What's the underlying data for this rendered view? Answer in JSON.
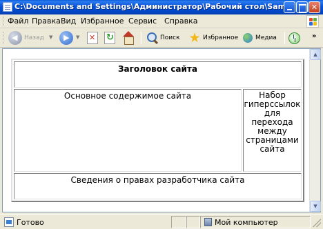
{
  "window": {
    "title": "C:\\Documents and Settings\\Администратор\\Рабочий стол\\Samples\\Macromed..."
  },
  "menu": {
    "items": [
      "Файл",
      "Правка",
      "Вид",
      "Избранное",
      "Сервис",
      "Справка"
    ]
  },
  "toolbar": {
    "back_label": "Назад",
    "search_label": "Поиск",
    "favorites_label": "Избранное",
    "media_label": "Медиа"
  },
  "page": {
    "header": "Заголовок сайта",
    "main_content": "Основное содержимое сайта",
    "sidebar": "Набор гиперссылок для перехода между страницами сайта",
    "footer": "Сведения о правах разработчика сайта"
  },
  "status": {
    "text": "Готово",
    "zone": "Мой компьютер"
  },
  "icons": {
    "back": "back-arrow-icon",
    "forward": "forward-arrow-icon",
    "stop": "stop-icon",
    "refresh": "refresh-icon",
    "home": "home-icon",
    "search": "search-icon",
    "favorites": "star-icon",
    "media": "media-icon",
    "history": "history-icon"
  }
}
